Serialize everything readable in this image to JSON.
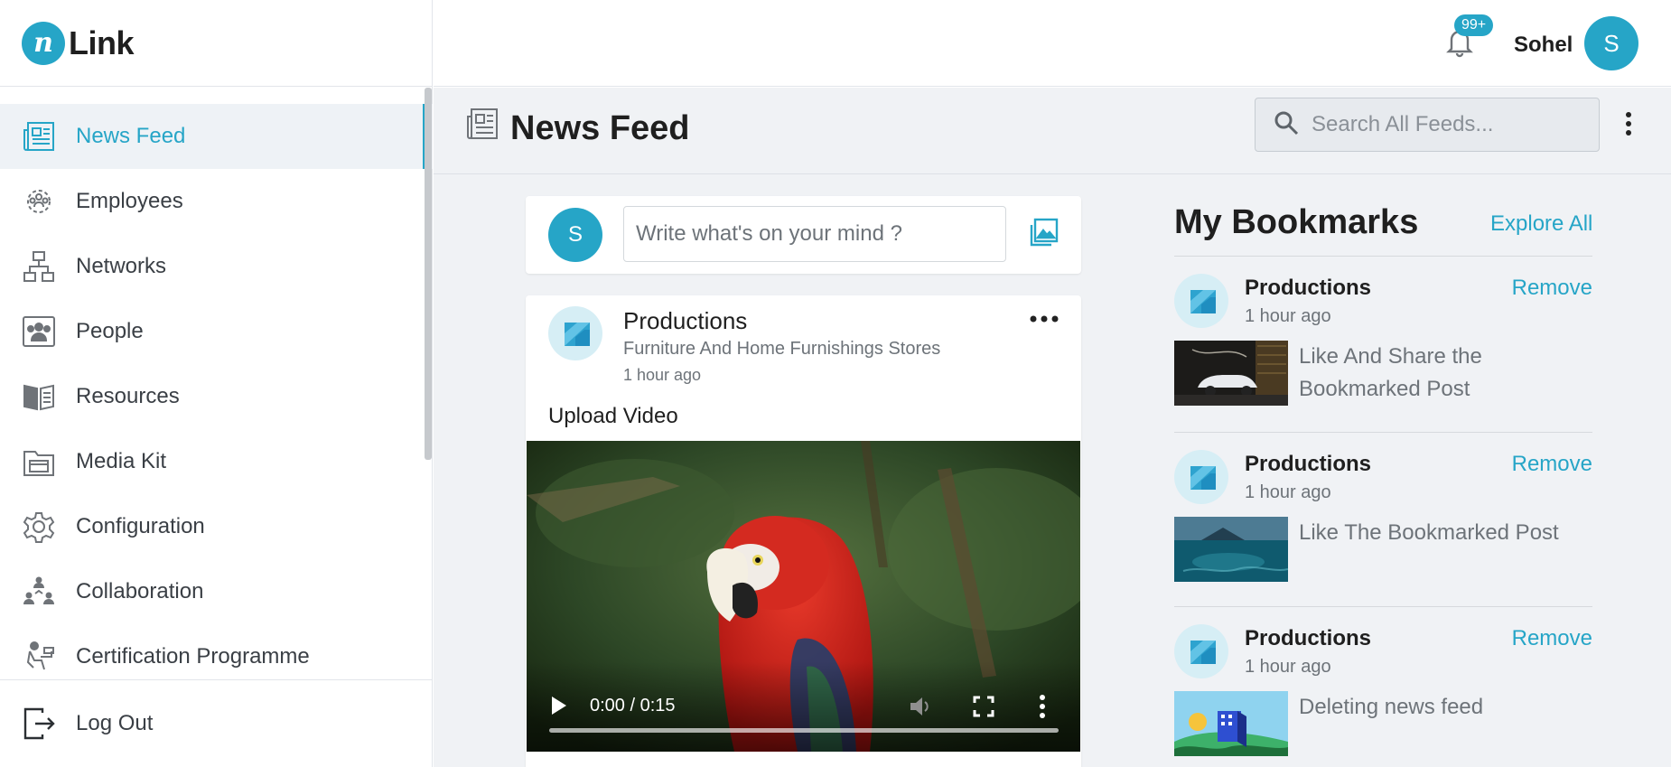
{
  "app": {
    "logo_letter": "n",
    "logo_text": "Link"
  },
  "sidebar": {
    "items": [
      {
        "label": "News Feed",
        "icon": "newspaper-icon",
        "active": true
      },
      {
        "label": "Employees",
        "icon": "employees-icon"
      },
      {
        "label": "Networks",
        "icon": "network-icon"
      },
      {
        "label": "People",
        "icon": "people-icon"
      },
      {
        "label": "Resources",
        "icon": "book-icon"
      },
      {
        "label": "Media Kit",
        "icon": "media-kit-icon"
      },
      {
        "label": "Configuration",
        "icon": "gear-icon"
      },
      {
        "label": "Collaboration",
        "icon": "collaboration-icon"
      },
      {
        "label": "Certification Programme",
        "icon": "certification-icon"
      }
    ],
    "logout_label": "Log Out"
  },
  "topbar": {
    "notification_count": "99+",
    "user_name": "Sohel",
    "user_initial": "S"
  },
  "header": {
    "title": "News Feed",
    "search_placeholder": "Search All Feeds..."
  },
  "composer": {
    "avatar_initial": "S",
    "placeholder": "Write what's on your mind ?"
  },
  "post": {
    "author": "Productions",
    "subtitle": "Furniture And Home Furnishings Stores",
    "time": "1 hour ago",
    "text": "Upload Video",
    "video": {
      "time_display": "0:00 / 0:15",
      "progress": 0
    }
  },
  "bookmarks": {
    "title": "My Bookmarks",
    "explore_label": "Explore All",
    "remove_label": "Remove",
    "items": [
      {
        "name": "Productions",
        "time": "1 hour ago",
        "text": "Like And Share the Bookmarked Post",
        "thumb": "car-thumbnail"
      },
      {
        "name": "Productions",
        "time": "1 hour ago",
        "text": "Like The Bookmarked Post",
        "thumb": "ocean-thumbnail"
      },
      {
        "name": "Productions",
        "time": "1 hour ago",
        "text": "Deleting news feed",
        "thumb": "psd-file-thumbnail"
      }
    ]
  },
  "colors": {
    "accent": "#26a5c7",
    "background": "#f0f2f5",
    "text": "#1f1f1f",
    "muted": "#6d7379"
  }
}
